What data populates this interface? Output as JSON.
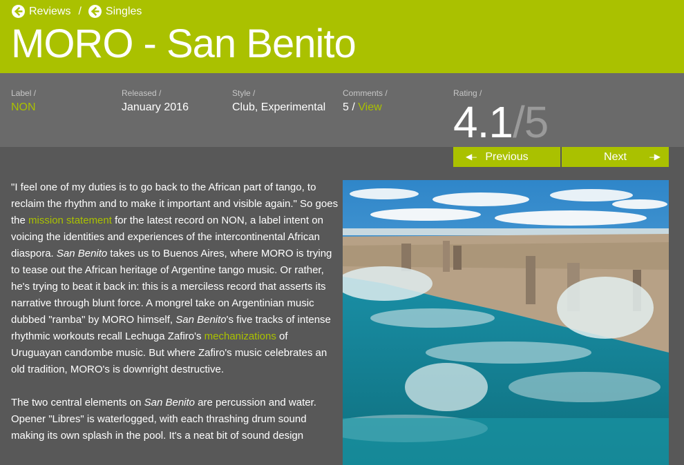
{
  "breadcrumb": {
    "items": [
      {
        "label": "Reviews",
        "icon": "arrow-left-circle-icon"
      },
      {
        "label": "Singles",
        "icon": "arrow-left-circle-icon"
      }
    ],
    "separator": "/"
  },
  "title": "MORO - San Benito",
  "meta": {
    "label": {
      "label": "Label /",
      "value": "NON"
    },
    "released": {
      "label": "Released /",
      "value": "January 2016"
    },
    "style": {
      "label": "Style /",
      "value": "Club, Experimental"
    },
    "comments": {
      "label": "Comments /",
      "count": "5",
      "separator": " / ",
      "link": "View"
    },
    "rating": {
      "label": "Rating /",
      "value": "4.1",
      "max": "/5"
    }
  },
  "nav": {
    "previous": "Previous",
    "next": "Next",
    "previous_icon": "arrow-left-icon",
    "next_icon": "arrow-right-icon"
  },
  "article": {
    "p1": {
      "t1": "\"I feel one of my duties is to go back to the African part of tango, to reclaim the rhythm and to make it important and visible again.\" So goes the ",
      "link1": "mission statement",
      "t2": " for the latest record on NON, a label intent on voicing the identities and experiences of the intercontinental African diaspora. ",
      "em1": "San Benito",
      "t3": " takes us to Buenos Aires, where MORO is trying to tease out the African heritage of Argentine tango music. Or rather, he's trying to beat it back in: this is a merciless record that asserts its narrative through blunt force. A mongrel take on Argentinian music dubbed \"ramba\" by MORO himself, ",
      "em2": "San Benito",
      "t4": "'s five tracks of intense rhythmic workouts recall Lechuga Zafiro's ",
      "link2": "mechanizations",
      "t5": " of Uruguayan candombe music. But where Zafiro's music celebrates an old tradition, MORO's is downright destructive."
    },
    "p2": {
      "t1": "The two central elements on ",
      "em1": "San Benito",
      "t2": " are percussion and water. Opener \"Libres\" is waterlogged, with each thrashing drum sound making its own splash in the pool. It's a neat bit of sound design"
    }
  },
  "colors": {
    "accent": "#aac100",
    "meta_bg": "#6a6a6a",
    "body_bg": "#585858"
  }
}
